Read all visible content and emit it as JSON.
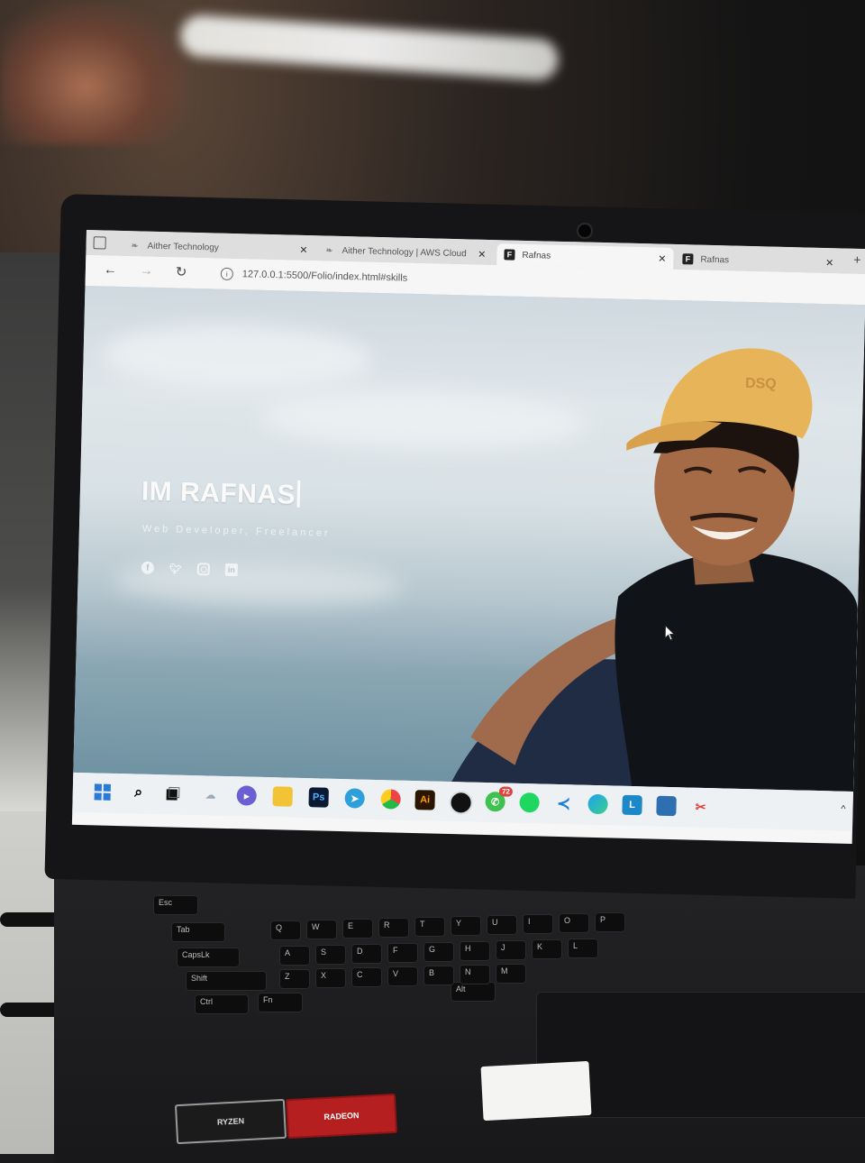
{
  "browser": {
    "tabs": [
      {
        "title": "Aither Technology",
        "active": false,
        "favicon": "leaf-icon"
      },
      {
        "title": "Aither Technology | AWS Cloud",
        "active": false,
        "favicon": "leaf-icon"
      },
      {
        "title": "Rafnas",
        "active": true,
        "favicon": "f-logo"
      },
      {
        "title": "Rafnas",
        "active": false,
        "favicon": "f-logo"
      }
    ],
    "url": "127.0.0.1:5500/Folio/index.html#skills"
  },
  "hero": {
    "title": "IM RAFNAS",
    "subtitle": "Web Developer, Freelancer",
    "socials": [
      "facebook-icon",
      "twitter-icon",
      "instagram-icon",
      "linkedin-icon"
    ]
  },
  "person": {
    "cap_text": "DSQ"
  },
  "taskbar": {
    "icons": [
      {
        "name": "windows-start-icon",
        "label": ""
      },
      {
        "name": "search-icon",
        "label": ""
      },
      {
        "name": "task-view-icon",
        "label": ""
      },
      {
        "name": "weather-icon",
        "label": ""
      },
      {
        "name": "teams-chat-icon",
        "label": ""
      },
      {
        "name": "file-explorer-icon",
        "label": ""
      },
      {
        "name": "photoshop-icon",
        "label": "Ps"
      },
      {
        "name": "telegram-icon",
        "label": ""
      },
      {
        "name": "chrome-icon",
        "label": ""
      },
      {
        "name": "illustrator-icon",
        "label": "Ai"
      },
      {
        "name": "app-icon",
        "label": ""
      },
      {
        "name": "whatsapp-icon",
        "label": "",
        "badge": "72"
      },
      {
        "name": "spotify-icon",
        "label": ""
      },
      {
        "name": "vscode-icon",
        "label": ""
      },
      {
        "name": "edge-icon",
        "label": ""
      },
      {
        "name": "launcher-icon",
        "label": "L"
      },
      {
        "name": "photos-icon",
        "label": ""
      },
      {
        "name": "snipping-tool-icon",
        "label": ""
      }
    ],
    "tray": "^"
  },
  "keyboard": {
    "keys": [
      "Esc",
      "Tab",
      "CapsLk",
      "Shift",
      "Ctrl",
      "Fn",
      "Alt",
      "Q",
      "W",
      "E",
      "R",
      "T",
      "Y",
      "U",
      "I",
      "O",
      "P",
      "A",
      "S",
      "D",
      "F",
      "G",
      "H",
      "J",
      "K",
      "L",
      "Z",
      "X",
      "C",
      "V",
      "B",
      "N",
      "M"
    ]
  },
  "stickers": {
    "ryzen": "RYZEN",
    "radeon": "RADEON"
  }
}
